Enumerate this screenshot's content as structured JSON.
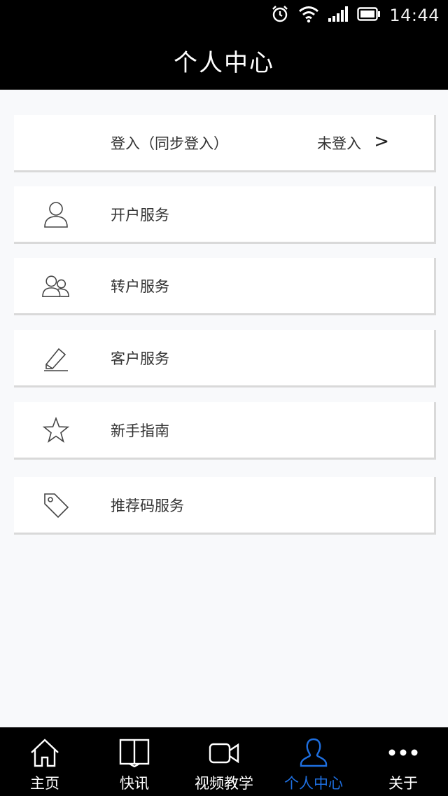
{
  "status_bar": {
    "time": "14:44",
    "icons": [
      "alarm-icon",
      "wifi-icon",
      "signal-icon",
      "battery-icon"
    ]
  },
  "header": {
    "title": "个人中心"
  },
  "menu": {
    "login": {
      "label": "登入（同步登入）",
      "status": "未登入",
      "chevron": ">"
    },
    "items": [
      {
        "label": "开户服务",
        "icon": "person-icon"
      },
      {
        "label": "转户服务",
        "icon": "people-icon"
      },
      {
        "label": "客户服务",
        "icon": "pencil-icon"
      },
      {
        "label": "新手指南",
        "icon": "star-icon"
      },
      {
        "label": "推荐码服务",
        "icon": "tag-icon"
      }
    ]
  },
  "tabs": [
    {
      "label": "主页",
      "icon": "home-icon",
      "active": false
    },
    {
      "label": "快讯",
      "icon": "book-icon",
      "active": false
    },
    {
      "label": "视频教学",
      "icon": "video-icon",
      "active": false
    },
    {
      "label": "个人中心",
      "icon": "person-icon",
      "active": true
    },
    {
      "label": "关于",
      "icon": "more-icon",
      "active": false
    }
  ],
  "colors": {
    "accent": "#1e6fe0",
    "bar_bg": "#000000",
    "page_bg": "#f8f9fb"
  }
}
